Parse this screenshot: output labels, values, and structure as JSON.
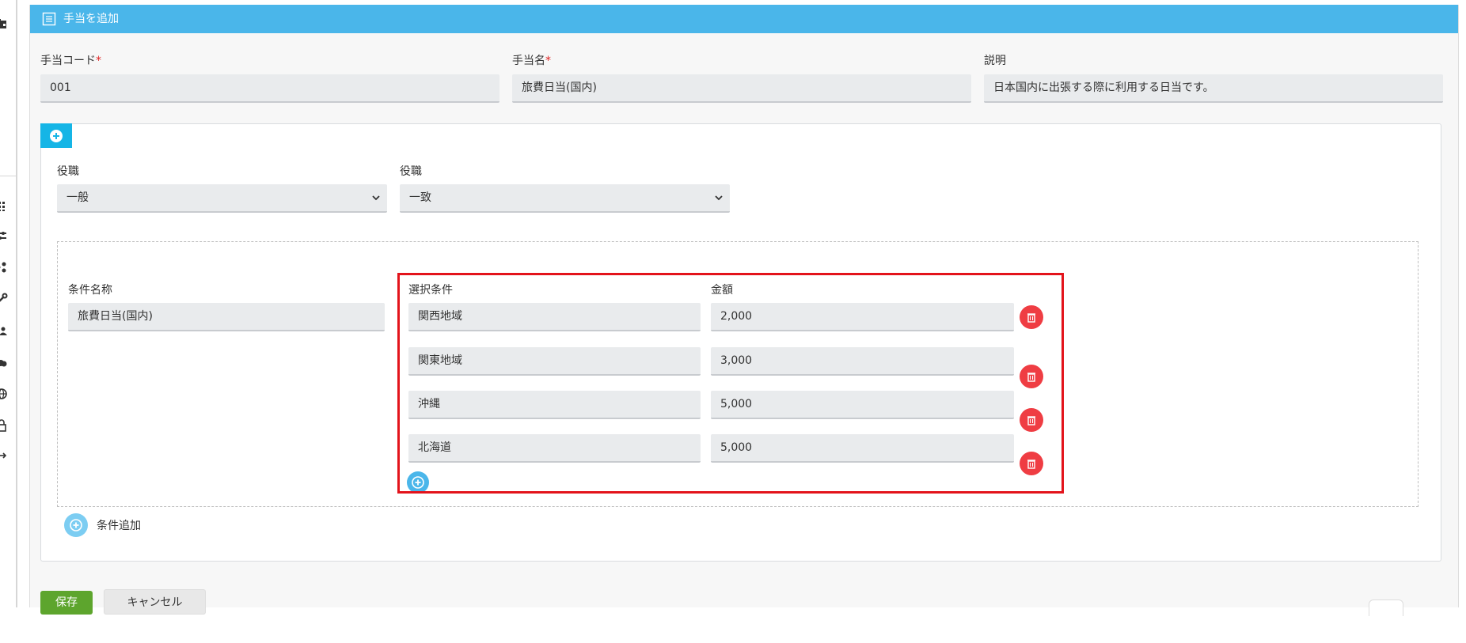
{
  "header": {
    "title": "手当を追加",
    "icon": "list-icon"
  },
  "form": {
    "code": {
      "label": "手当コード",
      "required_mark": "*",
      "value": "001"
    },
    "name": {
      "label": "手当名",
      "required_mark": "*",
      "value": "旅費日当(国内)"
    },
    "description": {
      "label": "説明",
      "value": "日本国内に出張する際に利用する日当です。"
    }
  },
  "filters": [
    {
      "label": "役職",
      "selected": "一般"
    },
    {
      "label": "役職",
      "selected": "一致"
    }
  ],
  "condition": {
    "name_label": "条件名称",
    "name_value": "旅費日当(国内)",
    "select_label": "選択条件",
    "amount_label": "金額",
    "rows": [
      {
        "region": "関西地域",
        "amount": "2,000"
      },
      {
        "region": "関東地域",
        "amount": "3,000"
      },
      {
        "region": "沖縄",
        "amount": "5,000"
      },
      {
        "region": "北海道",
        "amount": "5,000"
      }
    ]
  },
  "add_condition_label": "条件追加",
  "footer": {
    "save_label": "保存",
    "cancel_label": "キャンセル"
  },
  "colors": {
    "header_bg": "#4ab6ea",
    "delete_button": "#ef3d43",
    "save_button": "#5da52d",
    "highlight_border": "#e3131b",
    "plus_tab": "#15b5e6"
  }
}
